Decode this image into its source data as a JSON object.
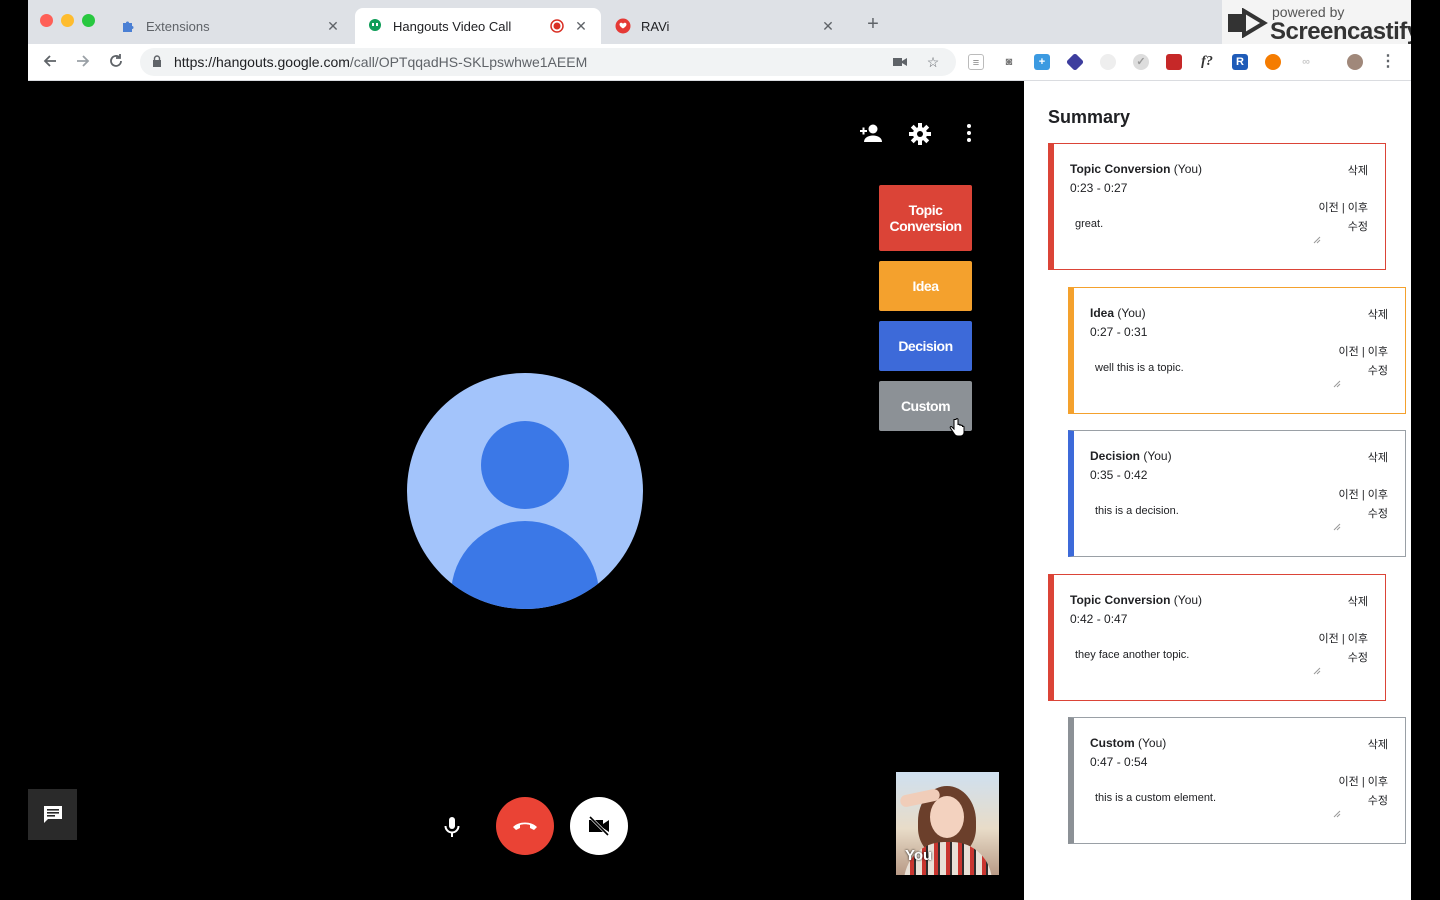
{
  "browser": {
    "tabs": [
      {
        "title": "Extensions",
        "icon": "puzzle-icon"
      },
      {
        "title": "Hangouts Video Call",
        "icon": "hangouts-icon",
        "recording": true
      },
      {
        "title": "RAVi",
        "icon": "ravi-icon"
      }
    ],
    "url_host": "https://hangouts.google.com",
    "url_path": "/call/OPTqqadHS-SKLpswhwe1AEEM"
  },
  "screencastify": {
    "powered": "powered by",
    "brand": "Screencastify"
  },
  "video": {
    "tag_buttons": [
      {
        "label": "Topic Conversion",
        "color": "#db4437"
      },
      {
        "label": "Idea",
        "color": "#f4a12d"
      },
      {
        "label": "Decision",
        "color": "#3d6ad9"
      },
      {
        "label": "Custom",
        "color": "#8c9196"
      }
    ],
    "self_label": "You"
  },
  "summary": {
    "title": "Summary",
    "delete_label": "삭제",
    "prevnext_label": "이전 | 이후",
    "edit_label": "수정",
    "cards": [
      {
        "type": "Topic Conversion",
        "author": "(You)",
        "time": "0:23 - 0:27",
        "text": "great.",
        "color": "#db4437"
      },
      {
        "type": "Idea",
        "author": "(You)",
        "time": "0:27 - 0:31",
        "text": "well this is a topic.",
        "color": "#f4a12d"
      },
      {
        "type": "Decision",
        "author": "(You)",
        "time": "0:35 - 0:42",
        "text": "this is a decision.",
        "color": "#3d6ad9"
      },
      {
        "type": "Topic Conversion",
        "author": "(You)",
        "time": "0:42 - 0:47",
        "text": "they face another topic.",
        "color": "#db4437"
      },
      {
        "type": "Custom",
        "author": "(You)",
        "time": "0:47 - 0:54",
        "text": "this is a custom element.",
        "color": "#8c9196"
      }
    ]
  }
}
